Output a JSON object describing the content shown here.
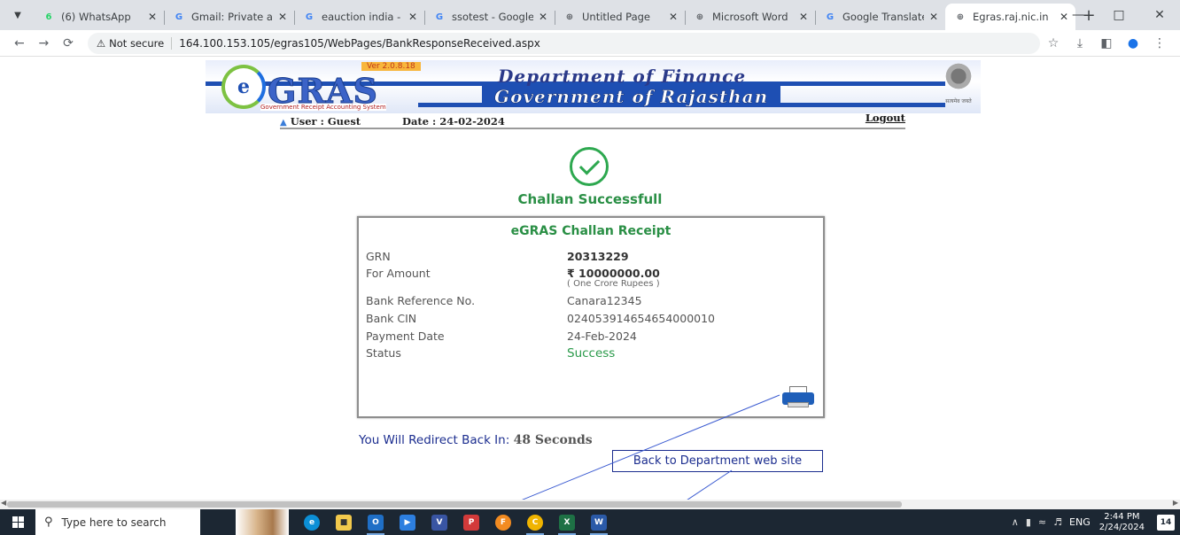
{
  "browser": {
    "tabs": [
      {
        "title": "(6) WhatsApp",
        "icon": "whatsapp-icon",
        "color": "#25d366",
        "glyph": "6"
      },
      {
        "title": "Gmail: Private an",
        "icon": "google-icon",
        "color": "#4285f4",
        "glyph": "G"
      },
      {
        "title": "eauction india - ",
        "icon": "google-icon",
        "color": "#4285f4",
        "glyph": "G"
      },
      {
        "title": "ssotest - Google",
        "icon": "google-icon",
        "color": "#4285f4",
        "glyph": "G"
      },
      {
        "title": "Untitled Page",
        "icon": "globe-icon",
        "color": "#5f6368",
        "glyph": "⊕"
      },
      {
        "title": "Microsoft Word",
        "icon": "globe-icon",
        "color": "#5f6368",
        "glyph": "⊕"
      },
      {
        "title": "Google Translate",
        "icon": "translate-icon",
        "color": "#4285f4",
        "glyph": "G"
      },
      {
        "title": "Egras.raj.nic.in",
        "icon": "globe-icon",
        "color": "#5f6368",
        "glyph": "⊕"
      }
    ],
    "new_tab": "+",
    "security_label": "Not secure",
    "url": "164.100.153.105/egras105/WebPages/BankResponseReceived.aspx"
  },
  "header": {
    "version": "Ver 2.0.8.18",
    "logo_letter": "e",
    "logo_text": "GRAS",
    "tagline": "Government Receipt Accounting System",
    "dept": "Department of Finance",
    "govt": "Government of Rajasthan",
    "motto": "सत्यमेव जयते",
    "user": "User : Guest",
    "date": "Date : 24-02-2024",
    "logout": "Logout"
  },
  "result": {
    "title": "Challan Successfull"
  },
  "receipt": {
    "heading": "eGRAS Challan Receipt",
    "rows": [
      {
        "label": "GRN",
        "value": "20313229"
      },
      {
        "label": "For Amount",
        "value": "₹ 10000000.00",
        "note": "( One Crore Rupees )"
      },
      {
        "label": "Bank Reference No.",
        "value": "Canara12345"
      },
      {
        "label": "Bank CIN",
        "value": "02405391465465400001​0"
      },
      {
        "label": "Payment Date",
        "value": "24-Feb-2024"
      },
      {
        "label": "Status",
        "value": "Success"
      }
    ]
  },
  "redirect": {
    "text": "You Will Redirect Back In:",
    "seconds": "48 Seconds"
  },
  "back_link": "Back to Department web site",
  "taskbar": {
    "search_placeholder": "Type here to search",
    "lang": "ENG",
    "time": "2:44 PM",
    "date": "2/24/2024",
    "notifications": "14"
  }
}
